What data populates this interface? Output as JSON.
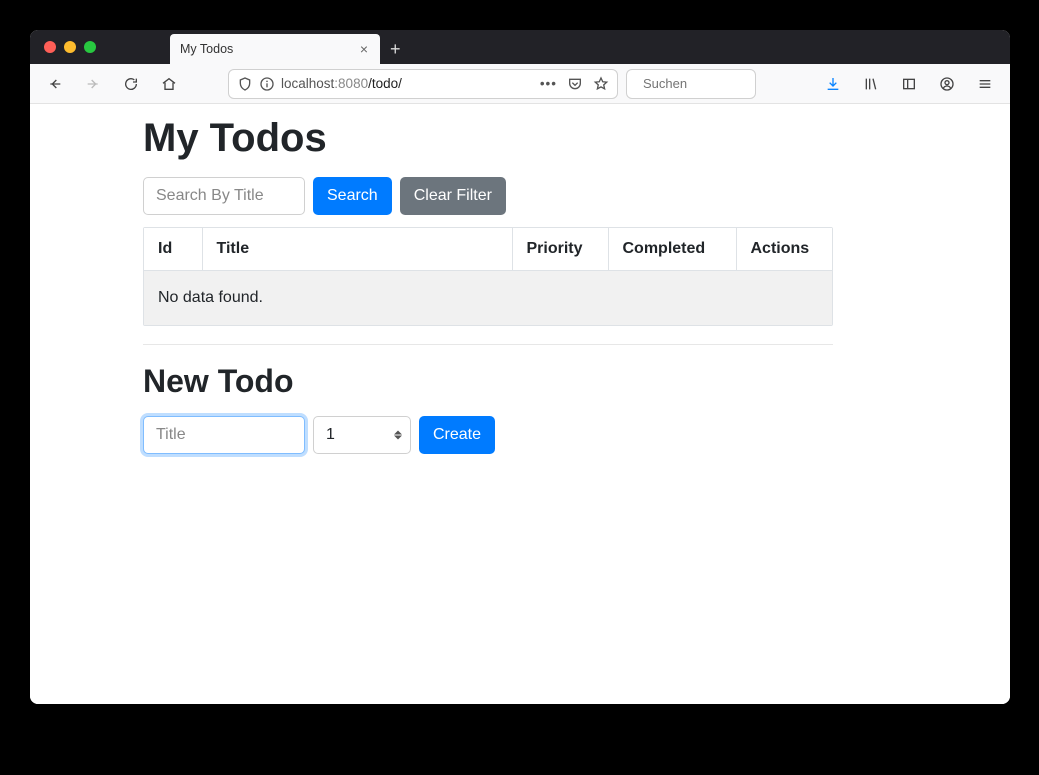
{
  "browser": {
    "tab_title": "My Todos",
    "address": {
      "host": "localhost",
      "port": ":8080",
      "path": "/todo/"
    },
    "search_placeholder": "Suchen"
  },
  "page": {
    "heading": "My Todos",
    "search": {
      "placeholder": "Search By Title",
      "value": "",
      "search_button": "Search",
      "clear_button": "Clear Filter"
    },
    "table": {
      "columns": [
        "Id",
        "Title",
        "Priority",
        "Completed",
        "Actions"
      ],
      "rows": [],
      "empty_text": "No data found."
    },
    "new_todo": {
      "heading": "New Todo",
      "title_placeholder": "Title",
      "title_value": "",
      "priority_selected": "1",
      "create_button": "Create"
    }
  }
}
